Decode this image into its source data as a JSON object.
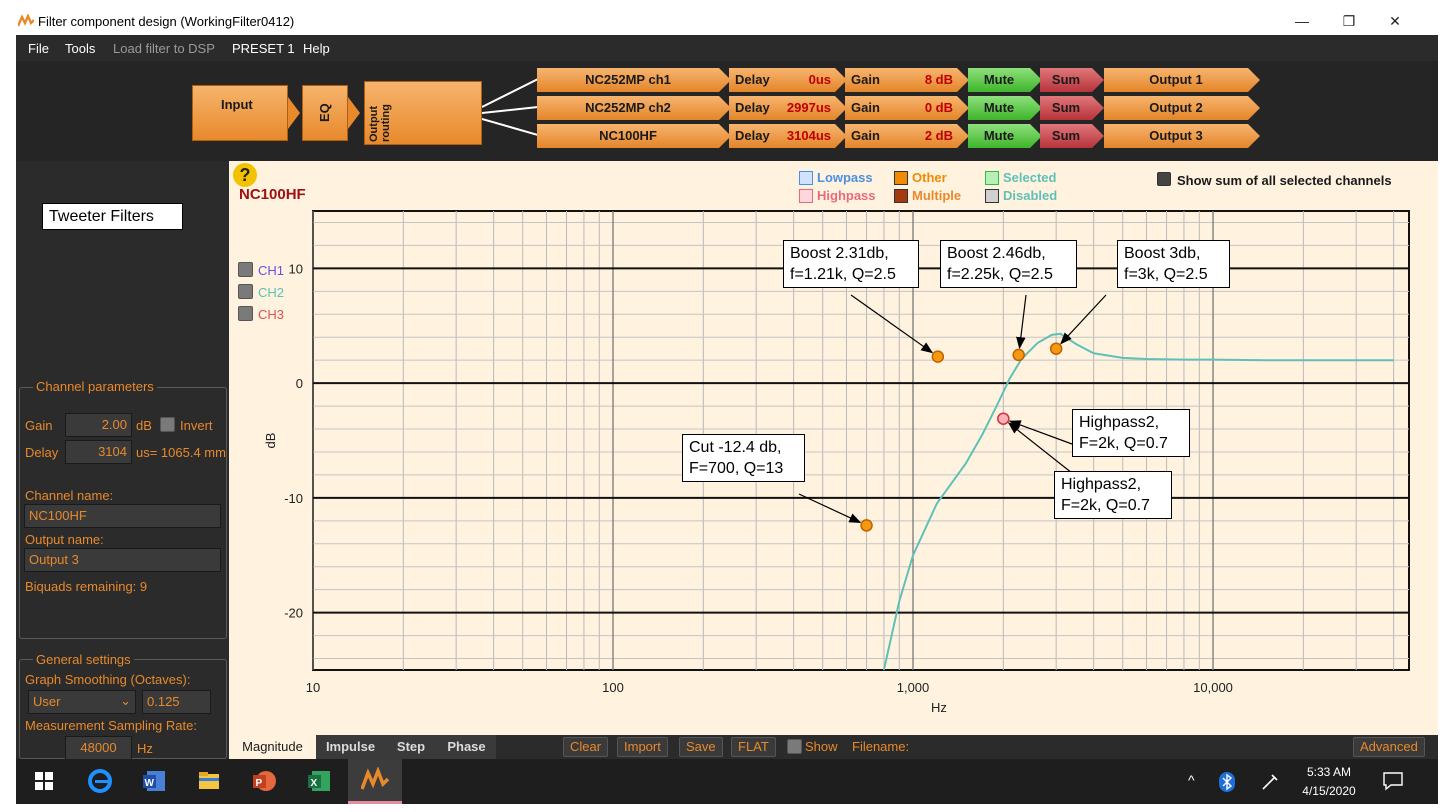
{
  "window": {
    "title": "Filter component design (WorkingFilter0412)",
    "min": "—",
    "max": "❐",
    "close": "✕"
  },
  "menu": {
    "file": "File",
    "tools": "Tools",
    "load": "Load filter to DSP",
    "preset": "PRESET 1",
    "help": "Help"
  },
  "pipeline": {
    "input": "Input",
    "eq": "EQ",
    "routing": "Output routing",
    "channels": [
      {
        "name": "NC252MP ch1",
        "delay_label": "Delay",
        "delay": "0us",
        "gain_label": "Gain",
        "gain": "8 dB",
        "mute": "Mute",
        "sum": "Sum",
        "output": "Output 1"
      },
      {
        "name": "NC252MP ch2",
        "delay_label": "Delay",
        "delay": "2997us",
        "gain_label": "Gain",
        "gain": "0 dB",
        "mute": "Mute",
        "sum": "Sum",
        "output": "Output 2"
      },
      {
        "name": "NC100HF",
        "delay_label": "Delay",
        "delay": "3104us",
        "gain_label": "Gain",
        "gain": "2 dB",
        "mute": "Mute",
        "sum": "Sum",
        "output": "Output 3"
      }
    ]
  },
  "left": {
    "annotation": "Tweeter Filters",
    "channel_params": {
      "legend": "Channel parameters",
      "gain_label": "Gain",
      "gain_value": "2.00",
      "gain_unit": "dB",
      "invert_label": "Invert",
      "delay_label": "Delay",
      "delay_value": "3104",
      "delay_unit": "us= 1065.4 mm",
      "channel_name_label": "Channel name:",
      "channel_name": "NC100HF",
      "output_name_label": "Output name:",
      "output_name": "Output 3",
      "biquads": "Biquads remaining: 9"
    },
    "general": {
      "legend": "General settings",
      "smoothing_label": "Graph Smoothing (Octaves):",
      "smoothing_mode": "User",
      "smoothing_value": "0.125",
      "sampling_label": "Measurement Sampling Rate:",
      "sampling_value": "48000",
      "sampling_unit": "Hz"
    }
  },
  "graph": {
    "help": "?",
    "channel_title": "NC100HF",
    "legend": {
      "lowpass": "Lowpass",
      "highpass": "Highpass",
      "other": "Other",
      "multiple": "Multiple",
      "selected": "Selected",
      "disabled": "Disabled"
    },
    "legend_colors": {
      "lowpass": "#4a90e2",
      "highpass": "#e86a7a",
      "other": "#f08a00",
      "multiple": "#a33a10",
      "selected": "#2fbf3a",
      "disabled": "#8a8a8a"
    },
    "show_sum": "Show sum of all selected channels",
    "channels": [
      "CH1",
      "CH2",
      "CH3"
    ],
    "channel_colors": [
      "#6a4ee0",
      "#5fc0b8",
      "#e05050"
    ],
    "annotations": {
      "a1_l1": "Boost 2.31db,",
      "a1_l2": "f=1.21k, Q=2.5",
      "a2_l1": "Boost 2.46db,",
      "a2_l2": "f=2.25k, Q=2.5",
      "a3_l1": "Boost 3db,",
      "a3_l2": "f=3k, Q=2.5",
      "a4_l1": "Highpass2,",
      "a4_l2": "F=2k, Q=0.7",
      "a5_l1": "Highpass2,",
      "a5_l2": "F=2k, Q=0.7",
      "a6_l1": "Cut -12.4 db,",
      "a6_l2": "F=700, Q=13"
    }
  },
  "chart_data": {
    "type": "line",
    "xlabel": "Hz",
    "ylabel": "dB",
    "xscale": "log",
    "xlim": [
      10,
      45000
    ],
    "ylim": [
      -25,
      15
    ],
    "x_ticks": [
      "10",
      "100",
      "1,000",
      "10,000"
    ],
    "y_ticks": [
      "10",
      "0",
      "-10",
      "-20"
    ],
    "grid": true,
    "series": [
      {
        "color": "#5fc0b8",
        "x": [
          800,
          900,
          1000,
          1200,
          1500,
          1700,
          1900,
          2100,
          2300,
          2600,
          2900,
          3100,
          3500,
          4000,
          5000,
          6000,
          8000,
          10000,
          15000,
          20000,
          30000,
          40000
        ],
        "y": [
          -25,
          -19,
          -15,
          -10.5,
          -7,
          -4.5,
          -2,
          0.4,
          2.1,
          3.5,
          4.2,
          4.3,
          3.4,
          2.6,
          2.2,
          2.1,
          2.05,
          2.05,
          2.0,
          2.0,
          2.0,
          2.0
        ]
      }
    ],
    "filter_points": [
      {
        "x": 1210,
        "y": 2.31,
        "kind": "other"
      },
      {
        "x": 2250,
        "y": 2.46,
        "kind": "other"
      },
      {
        "x": 3000,
        "y": 3.0,
        "kind": "other"
      },
      {
        "x": 2000,
        "y": -3.1,
        "kind": "highpass"
      },
      {
        "x": 700,
        "y": -12.4,
        "kind": "other"
      }
    ]
  },
  "bottom": {
    "tabs": [
      "Magnitude",
      "Impulse",
      "Step",
      "Phase"
    ],
    "clear": "Clear",
    "import": "Import",
    "save": "Save",
    "flat": "FLAT",
    "show": "Show",
    "filename": "Filename:",
    "advanced": "Advanced"
  },
  "taskbar": {
    "time": "5:33 AM",
    "date": "4/15/2020",
    "up": "^"
  }
}
